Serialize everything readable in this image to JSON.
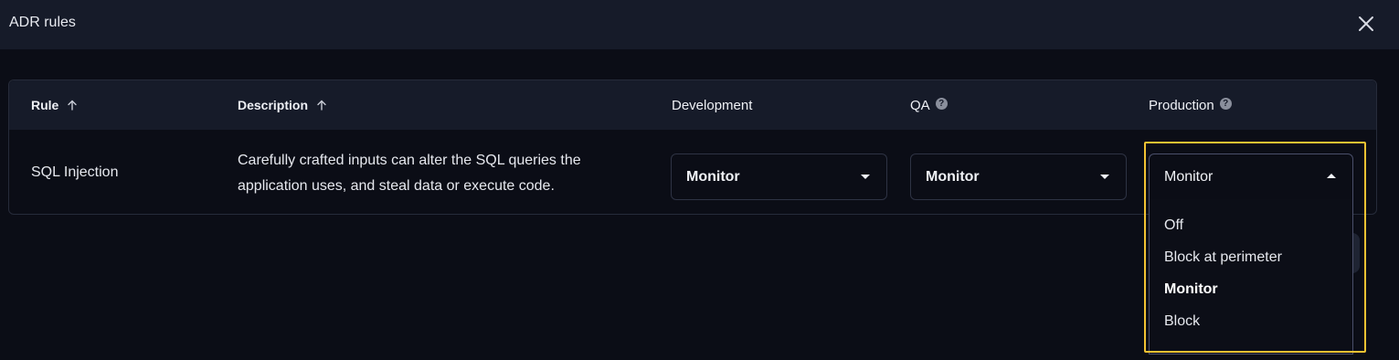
{
  "dialog": {
    "title": "ADR rules",
    "close_icon": "close-icon"
  },
  "table": {
    "columns": [
      {
        "label": "Rule",
        "sortable": true
      },
      {
        "label": "Description",
        "sortable": true
      },
      {
        "label": "Development",
        "help": false
      },
      {
        "label": "QA",
        "help": true
      },
      {
        "label": "Production",
        "help": true
      }
    ],
    "help_glyph": "?",
    "rows": [
      {
        "rule": "SQL Injection",
        "description_line1": "Carefully crafted inputs can alter the SQL queries the",
        "description_line2": "application uses, and steal data or execute code.",
        "development": "Monitor",
        "qa": "Monitor",
        "production": "Monitor"
      }
    ]
  },
  "production_dropdown": {
    "open": true,
    "options": [
      "Off",
      "Block at perimeter",
      "Monitor",
      "Block"
    ],
    "selected": "Monitor"
  },
  "colors": {
    "background": "#0b0d16",
    "header": "#161b29",
    "highlight": "#f2c232"
  }
}
